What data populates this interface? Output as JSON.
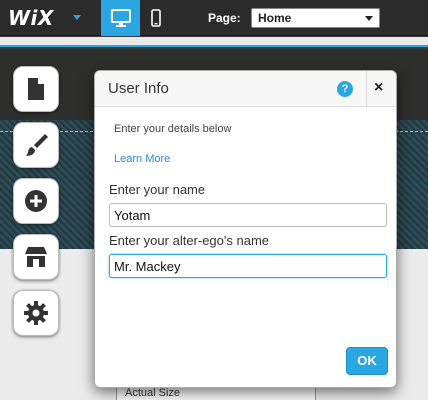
{
  "topbar": {
    "logo": "WiX",
    "page_label": "Page:",
    "page_selected": "Home"
  },
  "canvas": {
    "zoom_label": "Actual Size"
  },
  "tools": [
    {
      "icon": "pages-icon"
    },
    {
      "icon": "design-brush-icon"
    },
    {
      "icon": "add-icon"
    },
    {
      "icon": "app-market-icon"
    },
    {
      "icon": "settings-gear-icon"
    }
  ],
  "dialog": {
    "title": "User Info",
    "help": "?",
    "close": "×",
    "description": "Enter your details below",
    "learn_more": "Learn More",
    "name_label": "Enter your name",
    "name_value": "Yotam",
    "alter_label": "Enter your alter-ego's name",
    "alter_value": "Mr. Mackey",
    "ok_label": "OK"
  },
  "colors": {
    "accent": "#2aa7e2",
    "topbar": "#2b2b2b"
  }
}
